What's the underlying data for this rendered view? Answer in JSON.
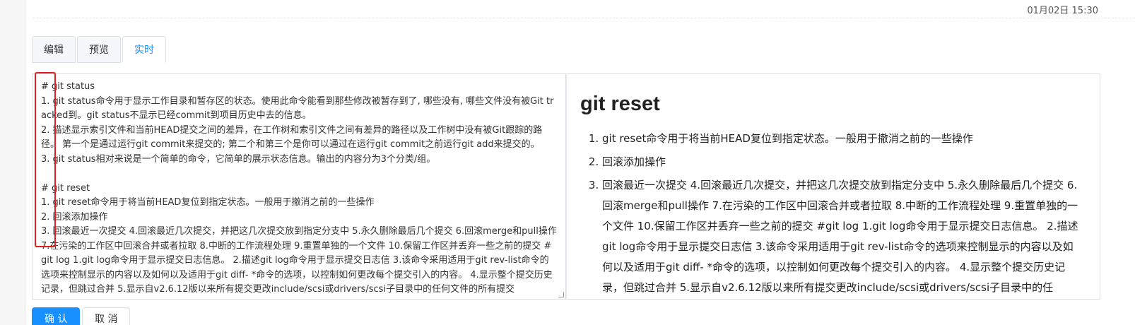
{
  "header": {
    "timestamp": "01月02日 15:30"
  },
  "tabs": [
    {
      "label": "编辑"
    },
    {
      "label": "预览"
    },
    {
      "label": "实时"
    }
  ],
  "editor": {
    "content": "# git status\n1. git status命令用于显示工作目录和暂存区的状态。使用此命令能看到那些修改被暂存到了, 哪些没有, 哪些文件没有被Git tracked到。git status不显示已经commit到项目历史中去的信息。\n2. 描述显示索引文件和当前HEAD提交之间的差异，在工作树和索引文件之间有差异的路径以及工作树中没有被Git跟踪的路径。 第一个是通过运行git commit来提交的; 第二个和第三个是你可以通过在运行git commit之前运行git add来提交的。\n3. git status相对来说是一个简单的命令，它简单的展示状态信息。输出的内容分为3个分类/组。\n\n# git reset\n1. git reset命令用于将当前HEAD复位到指定状态。一般用于撤消之前的一些操作\n2. 回滚添加操作\n3. 回滚最近一次提交 4.回滚最近几次提交，并把这几次提交放到指定分支中 5.永久删除最后几个提交 6.回滚merge和pull操作 7.在污染的工作区中回滚合并或者拉取 8.中断的工作流程处理 9.重置单独的一个文件 10.保留工作区并丢弃一些之前的提交 #git log 1.git log命令用于显示提交日志信息。 2.描述git log命令用于显示提交日志信 3.该命令采用适用于git rev-list命令的选项来控制显示的内容以及如何以及适用于git diff- *命令的选项，以控制如何更改每个提交引入的内容。 4.显示整个提交历史记录，但跳过合并 5.显示自v2.6.12版以来所有提交更改include/scsi或drivers/scsi子目录中的任何文件的所有提交"
  },
  "preview": {
    "heading": "git reset",
    "items": [
      "git reset命令用于将当前HEAD复位到指定状态。一般用于撤消之前的一些操作",
      "回滚添加操作",
      "回滚最近一次提交 4.回滚最近几次提交，并把这几次提交放到指定分支中 5.永久删除最后几个提交 6.回滚merge和pull操作 7.在污染的工作区中回滚合并或者拉取 8.中断的工作流程处理 9.重置单独的一个文件 10.保留工作区并丢弃一些之前的提交 #git log 1.git log命令用于显示提交日志信息。 2.描述git log命令用于显示提交日志信 3.该命令采用适用于git rev-list命令的选项来控制显示的内容以及如何以及适用于git diff- *命令的选项，以控制如何更改每个提交引入的内容。 4.显示整个提交历史记录，但跳过合并 5.显示自v2.6.12版以来所有提交更改include/scsi或drivers/scsi子目录中的任"
    ]
  },
  "buttons": {
    "confirm": "确 认",
    "cancel": "取 消"
  },
  "colors": {
    "accent": "#1890ff",
    "highlight_box": "#e02020"
  }
}
